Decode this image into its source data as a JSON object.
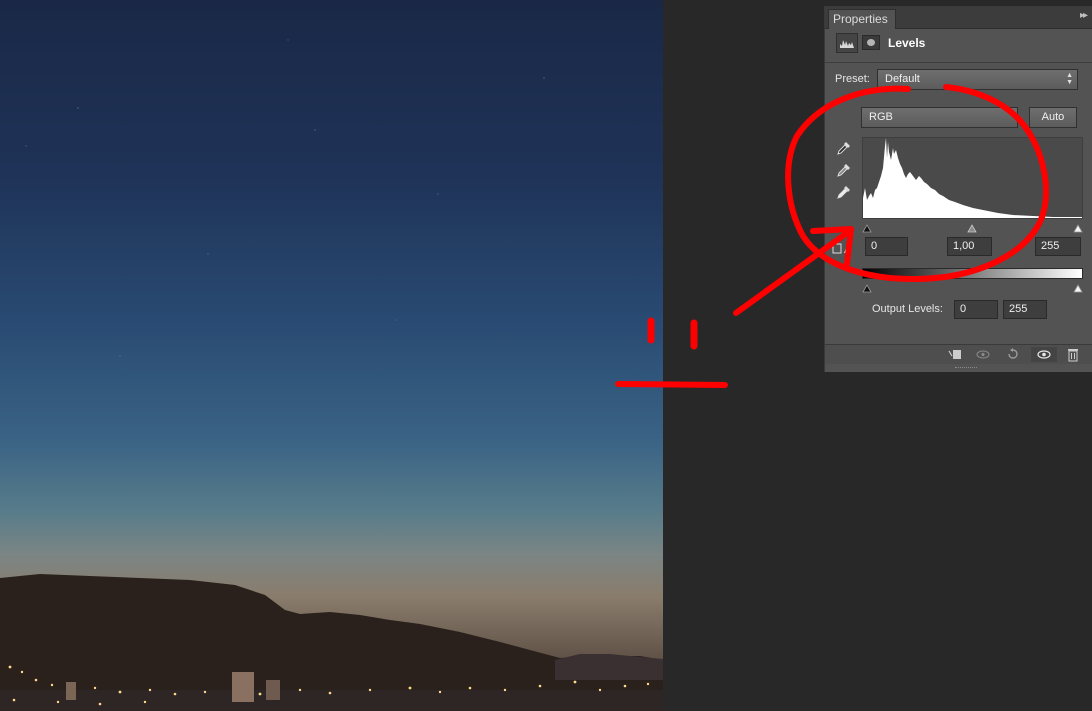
{
  "panel": {
    "tab_label": "Properties",
    "menu_glyph": "▸▸",
    "adjustment_title": "Levels",
    "preset": {
      "label": "Preset:",
      "value": "Default"
    },
    "channel": {
      "value": "RGB"
    },
    "auto_label": "Auto",
    "input_levels": {
      "black": "0",
      "gamma": "1,00",
      "white": "255"
    },
    "output": {
      "label": "Output Levels:",
      "black": "0",
      "white": "255"
    },
    "eyedroppers": [
      "black-point-eyedropper",
      "gray-point-eyedropper",
      "white-point-eyedropper"
    ],
    "bottom_icons": [
      "clip-to-layer-icon",
      "view-previous-state-icon",
      "reset-icon",
      "visibility-eye-icon",
      "trash-icon"
    ]
  },
  "colors": {
    "annotation": "#ff0000",
    "panel_bg": "#535353",
    "workspace_bg": "#282828"
  }
}
